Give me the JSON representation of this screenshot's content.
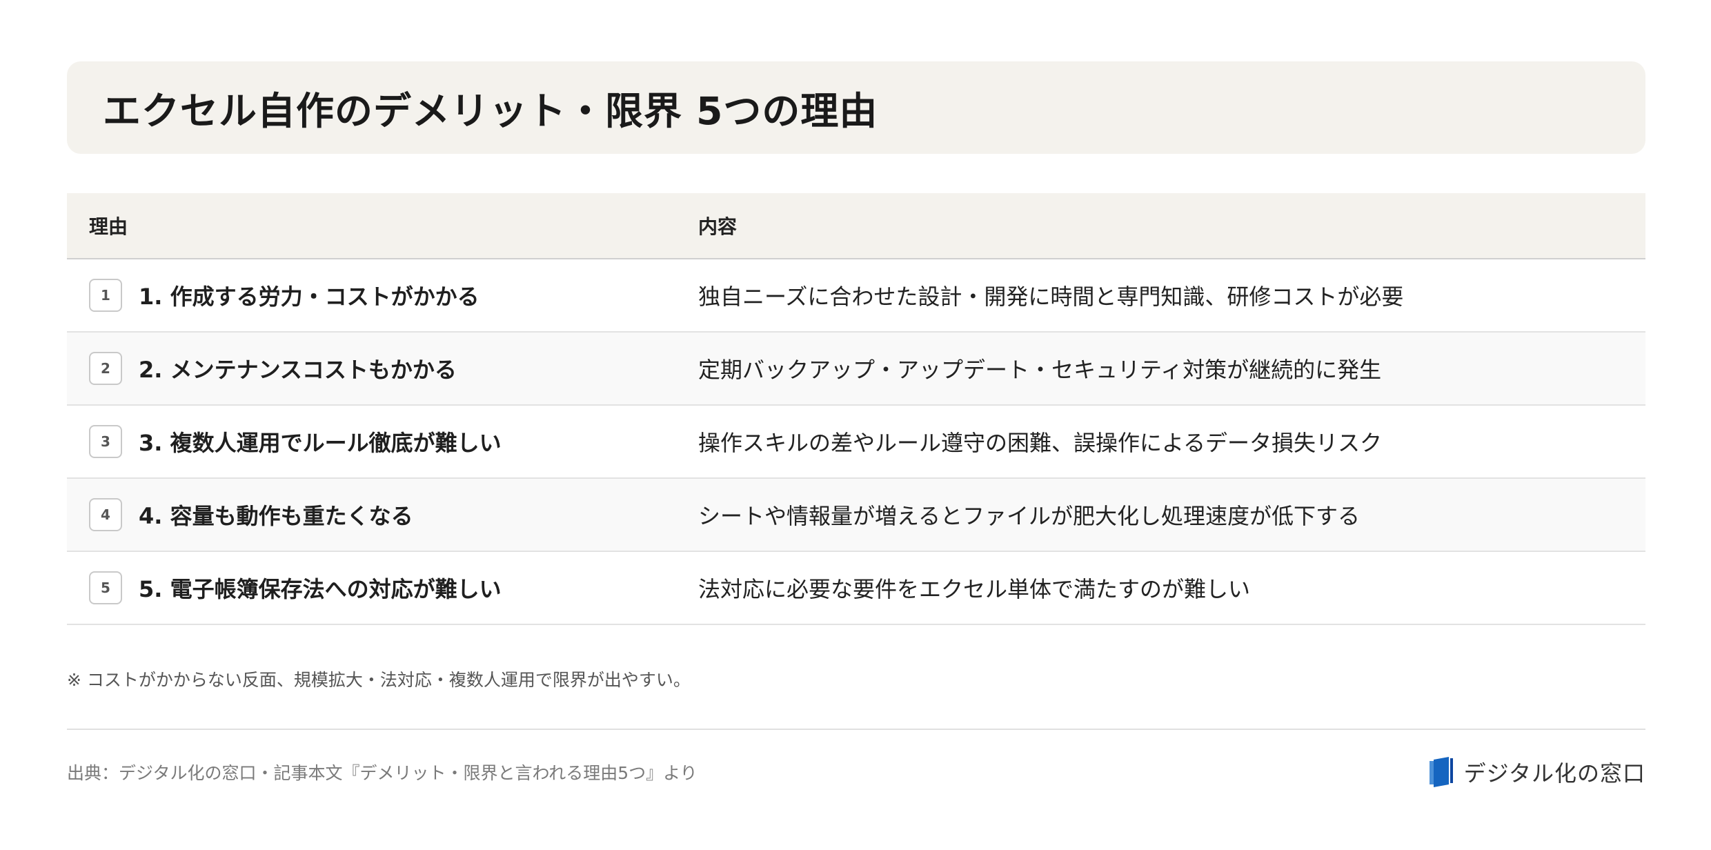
{
  "title": "エクセル自作のデメリット・限界 5つの理由",
  "table": {
    "headers": {
      "reason": "理由",
      "detail": "内容"
    },
    "rows": [
      {
        "badge": "1",
        "reason": "1. 作成する労力・コストがかかる",
        "detail": "独自ニーズに合わせた設計・開発に時間と専門知識、研修コストが必要"
      },
      {
        "badge": "2",
        "reason": "2. メンテナンスコストもかかる",
        "detail": "定期バックアップ・アップデート・セキュリティ対策が継続的に発生"
      },
      {
        "badge": "3",
        "reason": "3. 複数人運用でルール徹底が難しい",
        "detail": "操作スキルの差やルール遵守の困難、誤操作によるデータ損失リスク"
      },
      {
        "badge": "4",
        "reason": "4. 容量も動作も重たくなる",
        "detail": "シートや情報量が増えるとファイルが肥大化し処理速度が低下する"
      },
      {
        "badge": "5",
        "reason": "5. 電子帳簿保存法への対応が難しい",
        "detail": "法対応に必要な要件をエクセル単体で満たすのが難しい"
      }
    ]
  },
  "note": "※ コストがかからない反面、規模拡大・法対応・複数人運用で限界が出やすい。",
  "footer": {
    "source": "出典：デジタル化の窓口・記事本文『デメリット・限界と言われる理由5つ』より",
    "brand_name": "デジタル化の窓口",
    "brand_logo_icon": "book-logo-icon",
    "brand_color": "#1565c0"
  }
}
